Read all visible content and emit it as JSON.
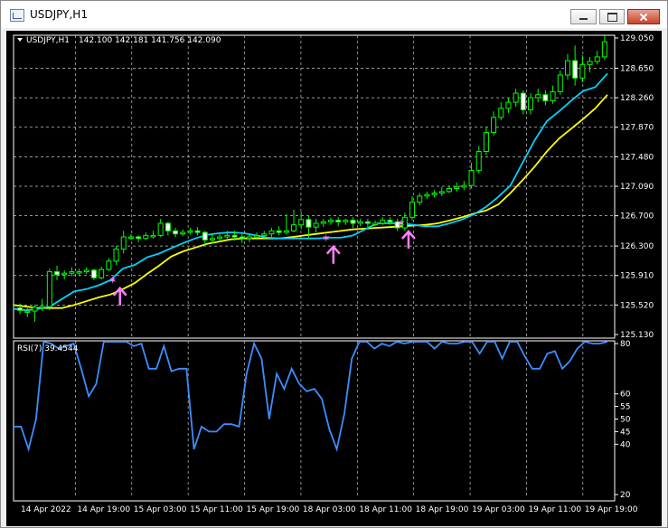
{
  "window": {
    "title": "USDJPY,H1"
  },
  "chart_data": [
    {
      "type": "candlestick",
      "symbol_label": "USDJPY,H1",
      "ohlc_label": "142.100 142.181 141.756 142.090",
      "y_ticks": [
        "129.050",
        "128.650",
        "128.260",
        "127.870",
        "127.480",
        "127.090",
        "126.700",
        "126.300",
        "125.910",
        "125.520",
        "125.130"
      ],
      "ylim": [
        125.13,
        129.05
      ],
      "x_ticks": [
        "14 Apr 2022",
        "14 Apr 19:00",
        "15 Apr 03:00",
        "15 Apr 11:00",
        "15 Apr 19:00",
        "18 Apr 03:00",
        "18 Apr 11:00",
        "18 Apr 19:00",
        "19 Apr 03:00",
        "19 Apr 11:00",
        "19 Apr 19:00"
      ],
      "grid": true,
      "colors": {
        "background": "#000000",
        "grid": "#c8c8c8",
        "candle": "#00ff00",
        "ma_fast": "#00d2ff",
        "ma_slow": "#ffff00",
        "signal": "#ff80ff",
        "rsi": "#3d8eff"
      },
      "ma_fast": [
        125.47,
        125.45,
        125.47,
        125.5,
        125.6,
        125.7,
        125.73,
        125.78,
        125.85,
        126,
        126.05,
        126.15,
        126.2,
        126.27,
        126.34,
        126.4,
        126.45,
        126.47,
        126.48,
        126.47,
        126.44,
        126.41,
        126.4,
        126.4,
        126.4,
        126.4,
        126.41,
        126.41,
        126.44,
        126.52,
        126.6,
        126.6,
        126.6,
        126.58,
        126.56,
        126.56,
        126.6,
        126.65,
        126.72,
        126.82,
        126.95,
        127.1,
        127.4,
        127.7,
        127.95,
        128.08,
        128.22,
        128.35,
        128.4,
        128.58
      ],
      "ma_slow": [
        125.52,
        125.5,
        125.48,
        125.48,
        125.48,
        125.52,
        125.57,
        125.62,
        125.66,
        125.73,
        125.81,
        125.93,
        126.04,
        126.16,
        126.23,
        126.28,
        126.33,
        126.36,
        126.39,
        126.4,
        126.4,
        126.4,
        126.4,
        126.42,
        126.44,
        126.46,
        126.48,
        126.5,
        126.52,
        126.53,
        126.54,
        126.55,
        126.56,
        126.57,
        126.58,
        126.6,
        126.64,
        126.68,
        126.73,
        126.77,
        126.85,
        127.0,
        127.17,
        127.35,
        127.55,
        127.72,
        127.85,
        127.98,
        128.12,
        128.3
      ],
      "candles": [
        [
          125.48,
          125.45,
          125.54,
          125.4
        ],
        [
          125.44,
          125.44,
          125.5,
          125.36
        ],
        [
          125.44,
          125.49,
          125.52,
          125.3
        ],
        [
          125.49,
          125.5,
          125.6,
          125.44
        ],
        [
          125.5,
          125.96,
          126.0,
          125.45
        ],
        [
          125.96,
          125.92,
          126.04,
          125.85
        ],
        [
          125.92,
          125.94,
          125.98,
          125.86
        ],
        [
          125.94,
          125.96,
          126.02,
          125.9
        ],
        [
          125.96,
          125.96,
          126.0,
          125.9
        ],
        [
          125.96,
          125.98,
          126.02,
          125.93
        ],
        [
          125.98,
          125.88,
          126.0,
          125.85
        ],
        [
          125.88,
          125.99,
          126.03,
          125.86
        ],
        [
          125.99,
          126.1,
          126.14,
          125.97
        ],
        [
          126.1,
          126.26,
          126.3,
          126.05
        ],
        [
          126.26,
          126.42,
          126.5,
          126.2
        ],
        [
          126.42,
          126.42,
          126.46,
          126.38
        ],
        [
          126.42,
          126.4,
          126.44,
          126.35
        ],
        [
          126.4,
          126.44,
          126.48,
          126.38
        ],
        [
          126.44,
          126.44,
          126.5,
          126.4
        ],
        [
          126.44,
          126.6,
          126.66,
          126.42
        ],
        [
          126.6,
          126.5,
          126.62,
          126.44
        ],
        [
          126.5,
          126.46,
          126.54,
          126.42
        ],
        [
          126.46,
          126.48,
          126.52,
          126.43
        ],
        [
          126.48,
          126.5,
          126.54,
          126.45
        ],
        [
          126.5,
          126.48,
          126.55,
          126.44
        ],
        [
          126.48,
          126.38,
          126.5,
          126.3
        ],
        [
          126.38,
          126.4,
          126.46,
          126.33
        ],
        [
          126.4,
          126.42,
          126.46,
          126.36
        ],
        [
          126.42,
          126.44,
          126.5,
          126.38
        ],
        [
          126.44,
          126.42,
          126.5,
          126.37
        ],
        [
          126.42,
          126.4,
          126.46,
          126.34
        ],
        [
          126.4,
          126.42,
          126.46,
          126.35
        ],
        [
          126.42,
          126.44,
          126.48,
          126.38
        ],
        [
          126.44,
          126.46,
          126.5,
          126.4
        ],
        [
          126.46,
          126.5,
          126.54,
          126.42
        ],
        [
          126.5,
          126.48,
          126.56,
          126.44
        ],
        [
          126.48,
          126.5,
          126.72,
          126.45
        ],
        [
          126.5,
          126.58,
          126.78,
          126.48
        ],
        [
          126.58,
          126.65,
          126.75,
          126.52
        ],
        [
          126.65,
          126.55,
          126.7,
          126.4
        ],
        [
          126.55,
          126.6,
          126.66,
          126.48
        ],
        [
          126.6,
          126.62,
          126.66,
          126.55
        ],
        [
          126.62,
          126.64,
          126.68,
          126.58
        ],
        [
          126.64,
          126.62,
          126.68,
          126.56
        ],
        [
          126.62,
          126.64,
          126.66,
          126.58
        ],
        [
          126.64,
          126.6,
          126.68,
          126.54
        ],
        [
          126.6,
          126.62,
          126.66,
          126.56
        ],
        [
          126.62,
          126.6,
          126.66,
          126.55
        ],
        [
          126.6,
          126.6,
          126.64,
          126.56
        ],
        [
          126.6,
          126.64,
          126.68,
          126.58
        ],
        [
          126.64,
          126.62,
          126.68,
          126.58
        ],
        [
          126.62,
          126.54,
          126.66,
          126.5
        ],
        [
          126.54,
          126.68,
          126.74,
          126.5
        ],
        [
          126.68,
          126.88,
          126.96,
          126.64
        ],
        [
          126.88,
          126.96,
          127.0,
          126.84
        ],
        [
          126.96,
          126.98,
          127.02,
          126.92
        ],
        [
          126.98,
          127.0,
          127.04,
          126.94
        ],
        [
          127.0,
          127.02,
          127.08,
          126.96
        ],
        [
          127.02,
          127.06,
          127.1,
          127.0
        ],
        [
          127.06,
          127.08,
          127.14,
          127.02
        ],
        [
          127.08,
          127.1,
          127.16,
          127.04
        ],
        [
          127.1,
          127.3,
          127.4,
          127.06
        ],
        [
          127.3,
          127.55,
          127.62,
          127.26
        ],
        [
          127.55,
          127.8,
          127.88,
          127.5
        ],
        [
          127.8,
          128.0,
          128.08,
          127.76
        ],
        [
          128.0,
          128.12,
          128.2,
          127.96
        ],
        [
          128.12,
          128.2,
          128.26,
          128.06
        ],
        [
          128.2,
          128.32,
          128.38,
          128.14
        ],
        [
          128.32,
          128.1,
          128.36,
          128.04
        ],
        [
          128.1,
          128.26,
          128.32,
          128.04
        ],
        [
          128.26,
          128.3,
          128.38,
          128.2
        ],
        [
          128.3,
          128.22,
          128.36,
          128.16
        ],
        [
          128.22,
          128.34,
          128.42,
          128.18
        ],
        [
          128.34,
          128.56,
          128.62,
          128.3
        ],
        [
          128.56,
          128.75,
          128.84,
          128.5
        ],
        [
          128.75,
          128.52,
          128.95,
          128.42
        ],
        [
          128.52,
          128.7,
          128.82,
          128.46
        ],
        [
          128.7,
          128.74,
          128.8,
          128.6
        ],
        [
          128.74,
          128.8,
          128.88,
          128.7
        ],
        [
          128.8,
          129.0,
          129.08,
          128.76
        ]
      ]
    },
    {
      "type": "line",
      "label": "RSI(7) 39.4544",
      "ylim": [
        20,
        80
      ],
      "y_ticks": [
        "80",
        "60",
        "55",
        "50",
        "45",
        "40",
        "20"
      ],
      "values": [
        47,
        47,
        38,
        50,
        82,
        80,
        78,
        79,
        80,
        70,
        59,
        64,
        82,
        82,
        82,
        81,
        79,
        80,
        70,
        70,
        79,
        69,
        70,
        70,
        38,
        47,
        45,
        45,
        48,
        48,
        47,
        68,
        80,
        74,
        50,
        68,
        62,
        70,
        64,
        61,
        62,
        58,
        46,
        38,
        52,
        74,
        82,
        82,
        78,
        80,
        79,
        82,
        80,
        82,
        82,
        82,
        78,
        82,
        80,
        80,
        82,
        82,
        76,
        82,
        82,
        74,
        82,
        82,
        75,
        70,
        70,
        76,
        77,
        70,
        73,
        78,
        82,
        80,
        80,
        82
      ]
    }
  ]
}
